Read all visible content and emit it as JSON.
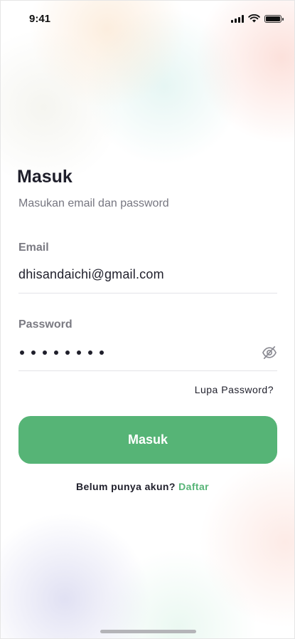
{
  "status_bar": {
    "time": "9:41",
    "signal_icon": "cellular-signal-icon",
    "wifi_icon": "wifi-icon",
    "battery_icon": "battery-icon"
  },
  "login": {
    "title": "Masuk",
    "subtitle": "Masukan email dan password",
    "email": {
      "label": "Email",
      "value": "dhisandaichi@gmail.com"
    },
    "password": {
      "label": "Password",
      "masked_length": 8,
      "toggle_icon": "eye-off-icon"
    },
    "forgot_password": "Lupa Password?",
    "submit_label": "Masuk",
    "register_prompt": "Belum punya akun?",
    "register_link": "Daftar"
  },
  "colors": {
    "accent": "#56b476",
    "text_primary": "#1f1f2b",
    "text_secondary": "#767680",
    "divider": "#e3e3e8"
  }
}
